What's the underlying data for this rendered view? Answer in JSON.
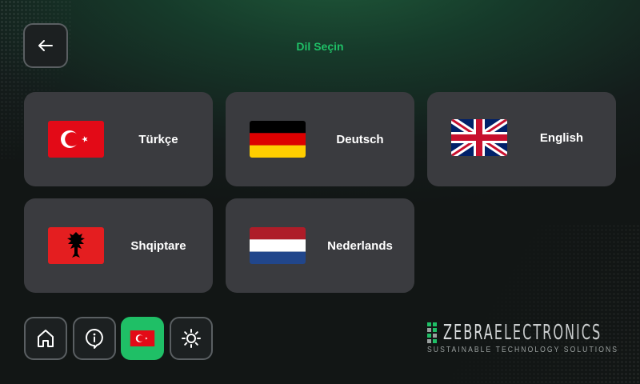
{
  "header": {
    "title": "Dil Seçin"
  },
  "languages": [
    {
      "label": "Türkçe",
      "flag": "turkey-flag-icon"
    },
    {
      "label": "Deutsch",
      "flag": "germany-flag-icon"
    },
    {
      "label": "English",
      "flag": "uk-flag-icon"
    },
    {
      "label": "Shqiptare",
      "flag": "albania-flag-icon"
    },
    {
      "label": "Nederlands",
      "flag": "netherlands-flag-icon"
    }
  ],
  "bottom_nav": [
    {
      "icon": "home-icon"
    },
    {
      "icon": "info-icon"
    },
    {
      "icon": "turkey-flag-icon",
      "active": true
    },
    {
      "icon": "brightness-icon"
    }
  ],
  "logo": {
    "brand_a": "ZEBRA",
    "brand_b": "ELECTRONICS",
    "tagline": "SUSTAINABLE TECHNOLOGY SOLUTIONS"
  },
  "colors": {
    "accent": "#1fbf66",
    "card": "#3a3b3f",
    "background": "#141c1b"
  }
}
